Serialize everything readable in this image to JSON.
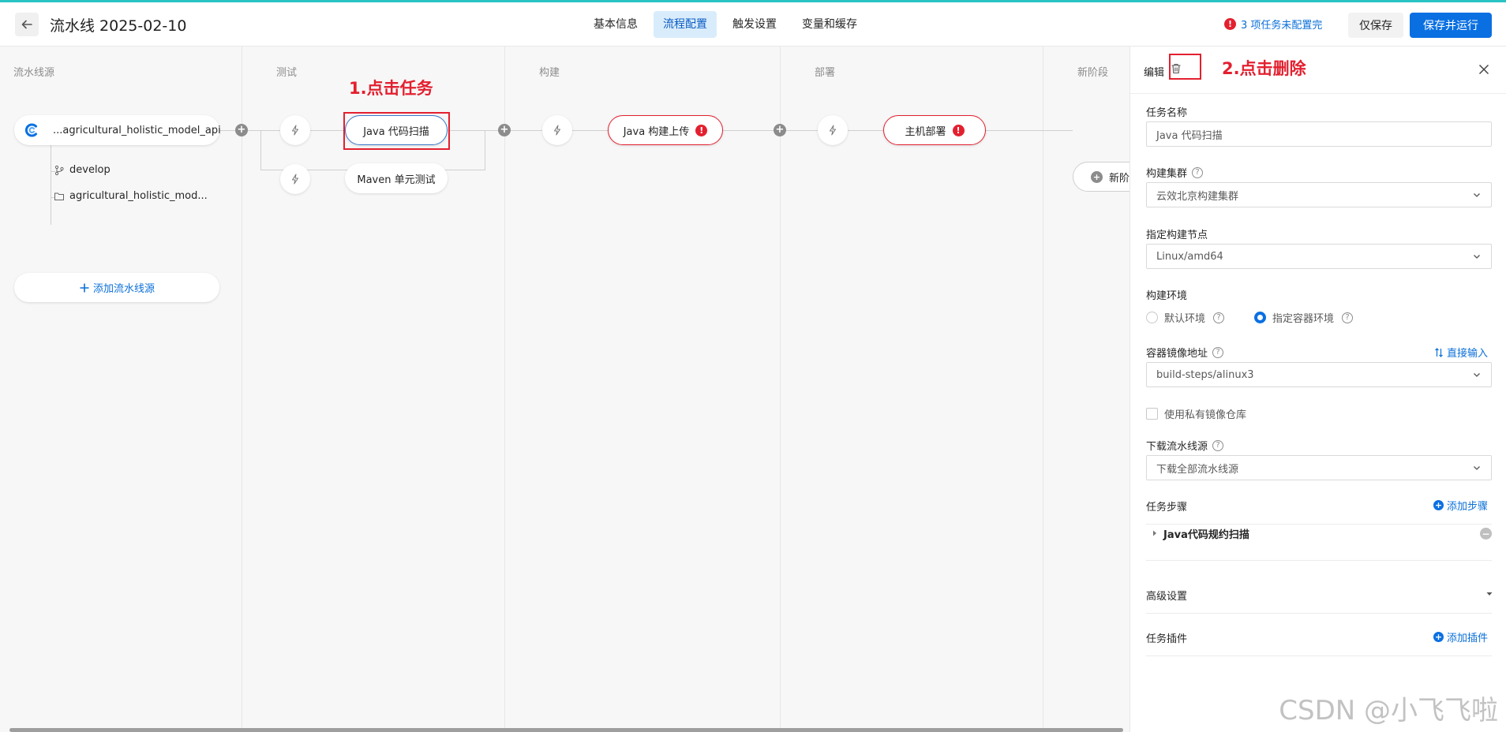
{
  "header": {
    "back_icon": "arrow-left-icon",
    "title": "流水线 2025-02-10",
    "tabs": [
      {
        "label": "基本信息",
        "active": false
      },
      {
        "label": "流程配置",
        "active": true
      },
      {
        "label": "触发设置",
        "active": false
      },
      {
        "label": "变量和缓存",
        "active": false
      }
    ],
    "warning": "3 项任务未配置完",
    "save_only": "仅保存",
    "save_run": "保存并运行"
  },
  "canvas": {
    "stages": [
      "流水线源",
      "测试",
      "构建",
      "部署",
      "新阶段"
    ],
    "source": {
      "name": "...agricultural_holistic_model_api",
      "branch": "develop",
      "repo": "agricultural_holistic_mod...",
      "add_label": "添加流水线源"
    },
    "tasks": {
      "java_scan": "Java 代码扫描",
      "maven_test": "Maven 单元测试",
      "java_build": "Java 构建上传",
      "host_deploy": "主机部署"
    },
    "error_mark": "!",
    "new_stage_label": "新阶",
    "annotations": {
      "step1": "1.点击任务",
      "step2": "2.点击删除"
    }
  },
  "panel": {
    "title": "编辑",
    "task_name_label": "任务名称",
    "task_name_value": "Java 代码扫描",
    "cluster_label": "构建集群",
    "cluster_value": "云效北京构建集群",
    "node_label": "指定构建节点",
    "node_value": "Linux/amd64",
    "env_label": "构建环境",
    "env_options": [
      "默认环境",
      "指定容器环境"
    ],
    "env_selected": 1,
    "image_label": "容器镜像地址",
    "image_link": "直接输入",
    "image_value": "build-steps/alinux3",
    "private_repo_label": "使用私有镜像仓库",
    "download_label": "下载流水线源",
    "download_value": "下载全部流水线源",
    "steps_label": "任务步骤",
    "add_step": "添加步骤",
    "step_item": "Java代码规约扫描",
    "advanced_label": "高级设置",
    "plugins_label": "任务插件",
    "add_plugin": "添加插件"
  },
  "watermark": "CSDN @小飞飞啦",
  "colors": {
    "accent": "#0a70e2",
    "error": "#e3202f",
    "active_tab_bg": "#d9ecfb",
    "top_bar": "#29c3c3"
  }
}
